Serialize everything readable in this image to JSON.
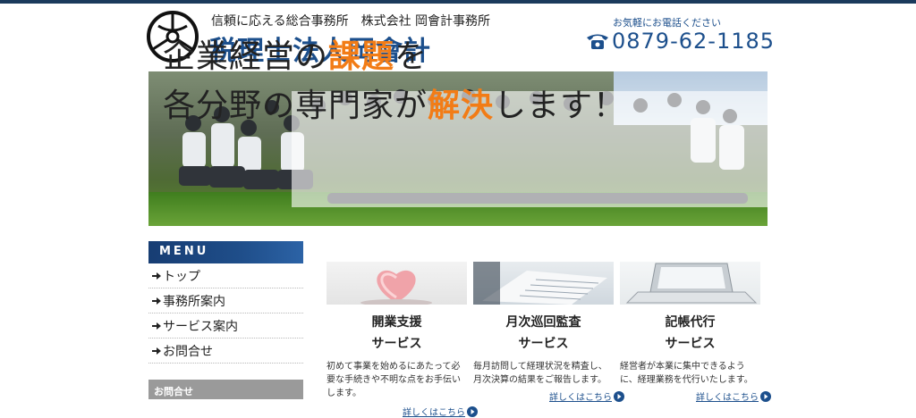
{
  "header": {
    "tagline": "信頼に応える総合事務所　株式会社 岡會計事務所",
    "company_name": "税理士法人岡會計",
    "tel_caption": "お気軽にお電話ください",
    "tel_number": "0879-62-1185",
    "logo_icon": "emblem-icon",
    "phone_icon": "telephone-icon"
  },
  "hero": {
    "line1_pre": "企業経営の",
    "line1_highlight": "課題",
    "line1_post": "を",
    "line2_pre": "各分野の専門家が",
    "line2_highlight": "解決",
    "line2_post": "します！",
    "highlight_color": "#f27c16"
  },
  "sidebar": {
    "menu_title": "MENU",
    "items": [
      {
        "label": "トップ"
      },
      {
        "label": "事務所案内"
      },
      {
        "label": "サービス案内"
      },
      {
        "label": "お問合せ"
      }
    ],
    "contact_title": "お問合せ"
  },
  "services": [
    {
      "title1": "開業支援",
      "title2": "サービス",
      "desc": "初めて事業を始めるにあたって必要な手続きや不明な点をお手伝いします。",
      "more": "詳しくはこちら"
    },
    {
      "title1": "月次巡回監査",
      "title2": "サービス",
      "desc": "毎月訪問して経理状況を精査し、月次決算の結果をご報告します。",
      "more": "詳しくはこちら"
    },
    {
      "title1": "記帳代行",
      "title2": "サービス",
      "desc": "経営者が本業に集中できるように、経理業務を代行いたします。",
      "more": "詳しくはこちら"
    }
  ],
  "colors": {
    "brand": "#1c4f8c",
    "menu_bar": "#1f4e8a",
    "accent": "#f27c16"
  }
}
